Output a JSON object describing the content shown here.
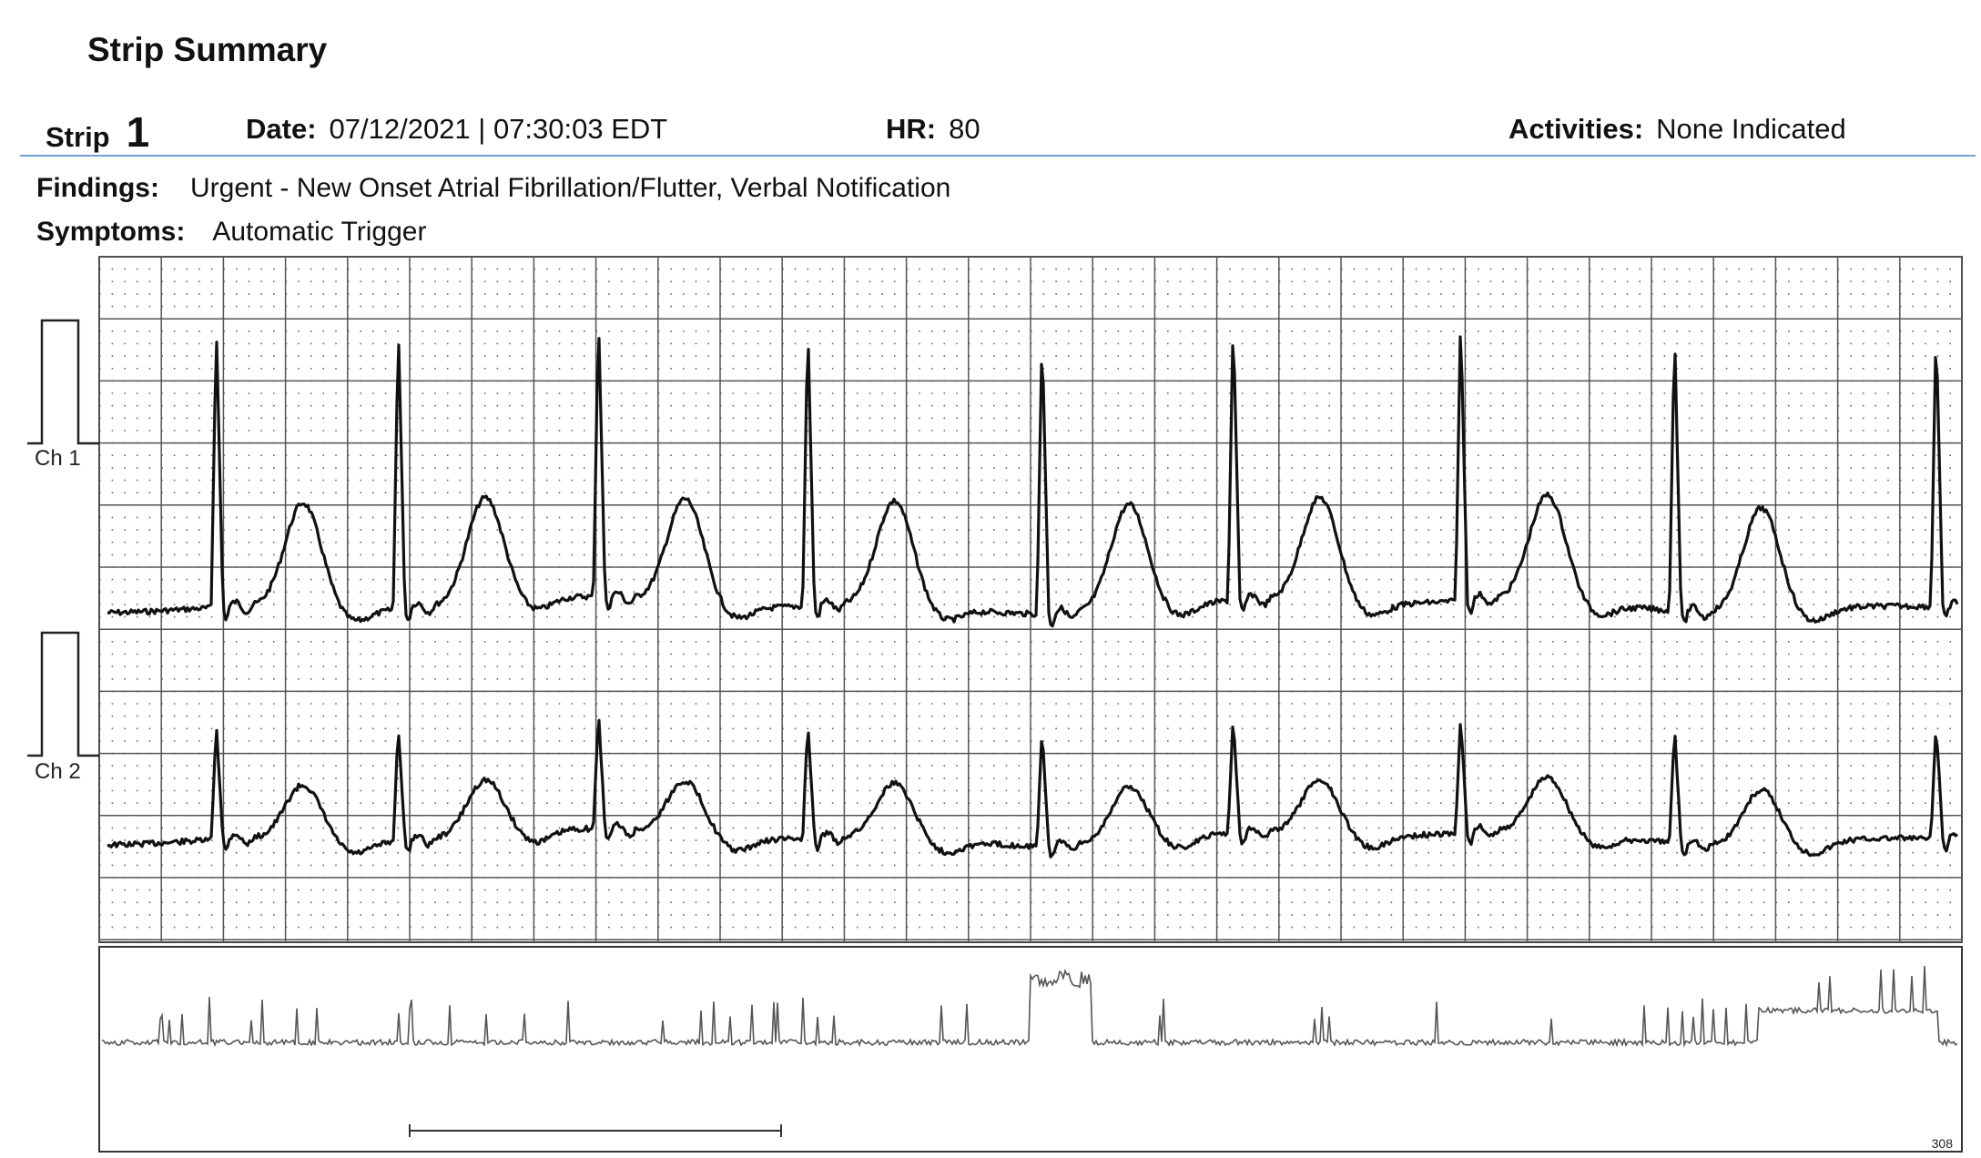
{
  "summary": {
    "title": "Strip Summary",
    "strip_label": "Strip",
    "strip_number": "1",
    "date_label": "Date:",
    "date_value": "07/12/2021 | 07:30:03 EDT",
    "hr_label": "HR:",
    "hr_value": "80",
    "activities_label": "Activities:",
    "activities_value": "None Indicated",
    "findings_label": "Findings:",
    "findings_value": "Urgent - New Onset Atrial Fibrillation/Flutter, Verbal Notification",
    "symptoms_label": "Symptoms:",
    "symptoms_value": "Automatic Trigger"
  },
  "channels": [
    {
      "label": "Ch 1"
    },
    {
      "label": "Ch 2"
    }
  ],
  "waveform": {
    "r_peaks_ms": [
      480,
      1280,
      2160,
      3080,
      4110,
      4950,
      5950,
      6890,
      8040
    ],
    "trace_color": "#111111",
    "grid_color": "#555555"
  },
  "trend": {
    "end_label": "308",
    "trace_color": "#555555"
  }
}
